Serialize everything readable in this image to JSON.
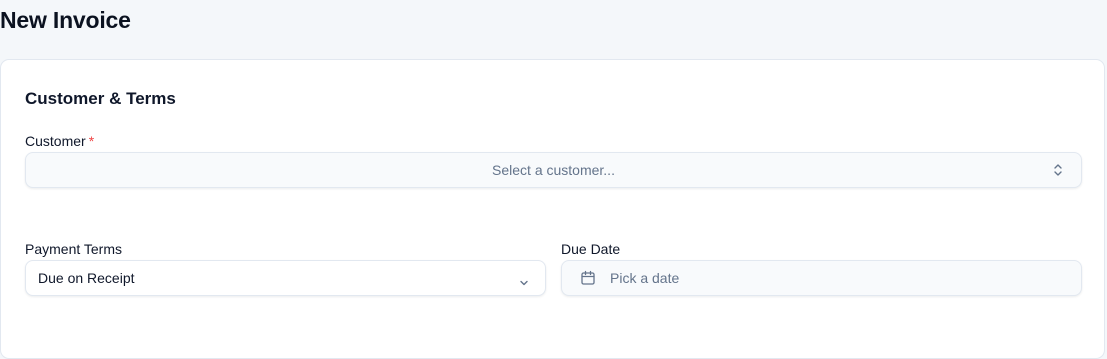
{
  "page": {
    "title": "New Invoice"
  },
  "card": {
    "section_title": "Customer & Terms"
  },
  "customer": {
    "label": "Customer",
    "required_mark": "*",
    "placeholder": "Select a customer...",
    "icon": "chevron-up-down-icon"
  },
  "payment_terms": {
    "label": "Payment Terms",
    "value": "Due on Receipt",
    "icon": "chevron-down-icon"
  },
  "due_date": {
    "label": "Due Date",
    "placeholder": "Pick a date",
    "icon": "calendar-icon"
  },
  "colors": {
    "background": "#f4f7fa",
    "card": "#ffffff",
    "border": "#e2e8f0",
    "required": "#ef4444",
    "muted_text": "#64748b"
  }
}
